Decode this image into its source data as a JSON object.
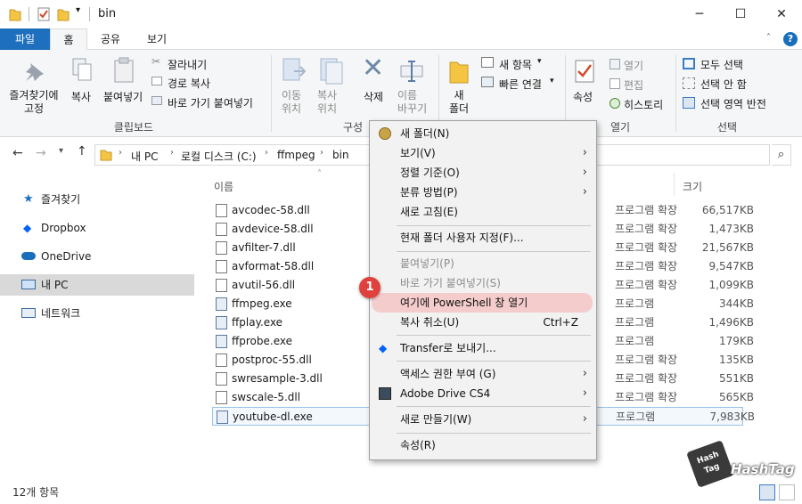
{
  "window": {
    "title": "bin",
    "minimize": "─",
    "maximize": "☐",
    "close": "✕"
  },
  "tabs": {
    "file": "파일",
    "home": "홈",
    "share": "공유",
    "view": "보기"
  },
  "ribbon": {
    "pin": "즐겨찾기에\n고정",
    "copy": "복사",
    "paste": "붙여넣기",
    "cut": "잘라내기",
    "copy_path": "경로 복사",
    "paste_shortcut": "바로 가기 붙여넣기",
    "clipboard_group": "클립보드",
    "move_to": "이동\n위치",
    "copy_to": "복사\n위치",
    "delete": "삭제",
    "rename": "이름\n바꾸기",
    "organize_group": "구성",
    "new_folder": "새\n폴더",
    "new_item": "새 항목",
    "easy_access": "빠른 연결",
    "properties": "속성",
    "open": "열기",
    "edit": "편집",
    "history": "히스토리",
    "open_group": "열기",
    "select_all": "모두 선택",
    "select_none": "선택 안 함",
    "invert_selection": "선택 영역 반전",
    "select_group": "선택"
  },
  "address": {
    "path": [
      "내 PC",
      "로컬 디스크 (C:)",
      "ffmpeg",
      "bin"
    ]
  },
  "nav": {
    "quick_access": "즐겨찾기",
    "dropbox": "Dropbox",
    "onedrive": "OneDrive",
    "this_pc": "내 PC",
    "network": "네트워크"
  },
  "columns": {
    "name": "이름",
    "size": "크기"
  },
  "files": [
    {
      "name": "avcodec-58.dll",
      "type": "프로그램 확장",
      "size": "66,517KB"
    },
    {
      "name": "avdevice-58.dll",
      "type": "프로그램 확장",
      "size": "1,473KB"
    },
    {
      "name": "avfilter-7.dll",
      "type": "프로그램 확장",
      "size": "21,567KB"
    },
    {
      "name": "avformat-58.dll",
      "type": "프로그램 확장",
      "size": "9,547KB"
    },
    {
      "name": "avutil-56.dll",
      "type": "프로그램 확장",
      "size": "1,099KB"
    },
    {
      "name": "ffmpeg.exe",
      "type": "프로그램",
      "size": "344KB"
    },
    {
      "name": "ffplay.exe",
      "type": "프로그램",
      "size": "1,496KB"
    },
    {
      "name": "ffprobe.exe",
      "type": "프로그램",
      "size": "179KB"
    },
    {
      "name": "postproc-55.dll",
      "type": "프로그램 확장",
      "size": "135KB"
    },
    {
      "name": "swresample-3.dll",
      "type": "프로그램 확장",
      "size": "551KB"
    },
    {
      "name": "swscale-5.dll",
      "type": "프로그램 확장",
      "size": "565KB"
    },
    {
      "name": "youtube-dl.exe",
      "type": "프로그램",
      "size": "7,983KB"
    }
  ],
  "status": {
    "count": "12개 항목"
  },
  "context_menu": {
    "new_folder": "새 폴더(N)",
    "view": "보기(V)",
    "sort_by": "정렬 기준(O)",
    "group_by": "분류 방법(P)",
    "refresh": "새로 고침(E)",
    "customize": "현재 폴더 사용자 지정(F)...",
    "paste": "붙여넣기(P)",
    "paste_shortcut": "바로 가기 붙여넣기(S)",
    "powershell": "여기에 PowerShell 창 열기",
    "undo": "복사 취소(U)",
    "undo_shortcut": "Ctrl+Z",
    "transfer": "Transfer로 보내기...",
    "access": "액세스 권한 부여 (G)",
    "adobe_drive": "Adobe Drive CS4",
    "new": "새로 만들기(W)",
    "properties": "속성(R)"
  },
  "callout": {
    "number": "1"
  },
  "watermark": {
    "text": "HashTag",
    "logo": "Hash Tag"
  },
  "colors": {
    "accent": "#1a6fbd",
    "file_tab": "#1e6fbe",
    "highlight": "#f5cccc",
    "badge": "#e0413c",
    "selected_nav": "#d9d9d9"
  }
}
